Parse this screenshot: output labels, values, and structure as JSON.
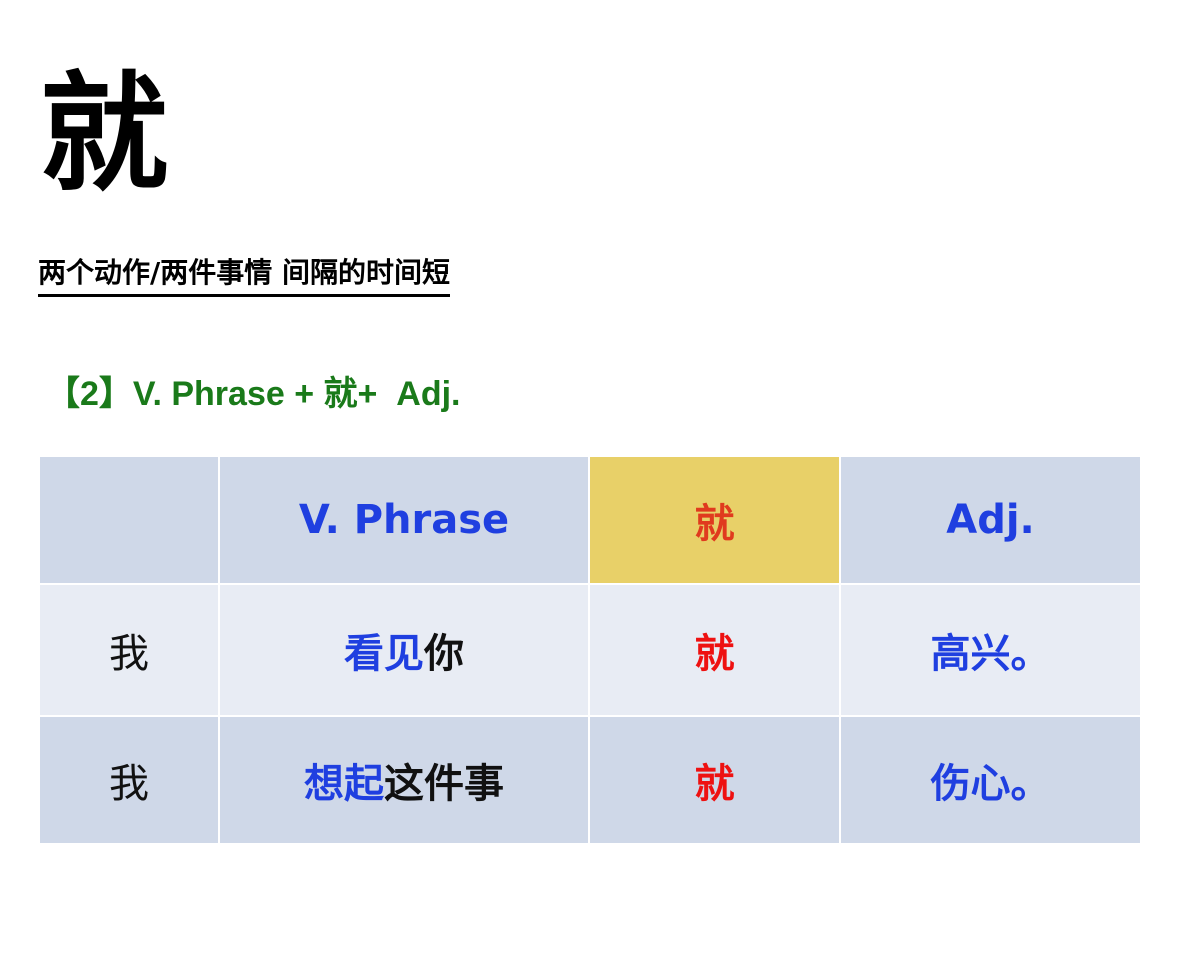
{
  "title_char": "就",
  "subtitle": "两个动作/两件事情 间隔的时间短",
  "pattern": "【2】V. Phrase + 就+  Adj.",
  "table": {
    "headers": [
      "",
      "V. Phrase",
      "就",
      "Adj."
    ],
    "rows": [
      {
        "subject": "我",
        "verb_phrase": "看见",
        "object": "你",
        "jiu": "就",
        "adj": "高兴。"
      },
      {
        "subject": "我",
        "verb_phrase": "想起",
        "object": "这件事",
        "jiu": "就",
        "adj": "伤心。"
      }
    ]
  },
  "colors": {
    "header_bg": "#cfd8e8",
    "row_light_bg": "#e8ecf4",
    "jiu_header_bg": "#e8d068",
    "blue_text": "#1f3fe0",
    "red_text": "#ee1111",
    "green_text": "#1a7a1a"
  }
}
